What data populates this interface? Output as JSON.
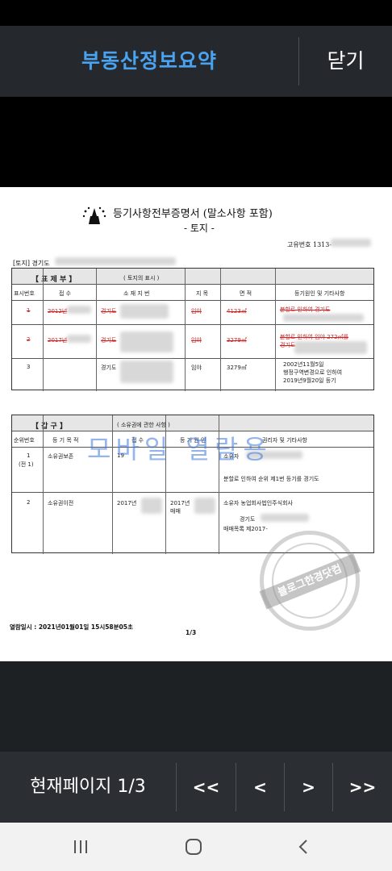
{
  "header": {
    "title": "부동산정보요약",
    "close_label": "닫기"
  },
  "document": {
    "title": "등기사항전부증명서 (말소사항 포함)",
    "subtitle": "- 토지 -",
    "unique_number": "고유번호 1313-",
    "land_label": "[토지] 경기도",
    "section1": {
      "label": "【  표  제  부  】",
      "sublabel": "( 토지의 표시 )",
      "headers": [
        "표시번호",
        "접  수",
        "소 재 지 번",
        "지  목",
        "면  적",
        "등기원인 및 기타사항"
      ],
      "rows": [
        {
          "no": "1",
          "receipt": "2012년",
          "location": "경기도",
          "category": "임야",
          "area": "4123㎡",
          "cause": "분할로 인하여 경기도"
        },
        {
          "no": "2",
          "receipt": "2017년",
          "location": "경기도",
          "category": "임야",
          "area": "3279㎡",
          "cause": "분할로 인하여 임야 272㎡를",
          "cause2": "경기도"
        },
        {
          "no": "3",
          "receipt": "",
          "location": "경기도",
          "category": "임야",
          "area": "3279㎡",
          "cause": "2002년11월5일",
          "cause2": "행정구역변경으로 인하여",
          "cause3": "2019년9월20일  등기"
        }
      ]
    },
    "section2": {
      "label": "【  갑        구  】",
      "sublabel": "( 소유권에 관한 사항 )",
      "headers": [
        "순위번호",
        "등 기 목 적",
        "접  수",
        "등 기 원 인",
        "권리자 및 기타사항"
      ],
      "rows": [
        {
          "no": "1",
          "no2": "(전 1)",
          "purpose": "소유권보존",
          "receipt": "19",
          "owner": "소유자",
          "note": "분할로 인하여 순위 제1번 등기를 경기도"
        },
        {
          "no": "2",
          "purpose": "소유권이전",
          "receipt": "2017년",
          "cause": "2017년",
          "cause2": "매매",
          "owner": "소유자  농업회사법인주식회사",
          "addr": "경기도",
          "note": "매매목록  제2017-"
        }
      ]
    },
    "watermark": "모바일 열람용",
    "stamp_text": "블로그한경닷컴",
    "view_datetime": "열람일시 : 2021년01월01일  15시58분05초",
    "page": "1/3"
  },
  "footer": {
    "page_indicator": "현재페이지 1/3",
    "first_label": "<<",
    "prev_label": "<",
    "next_label": ">",
    "last_label": ">>"
  },
  "system_nav": {
    "recent": "recent-apps-icon",
    "home": "home-icon",
    "back": "back-icon"
  }
}
